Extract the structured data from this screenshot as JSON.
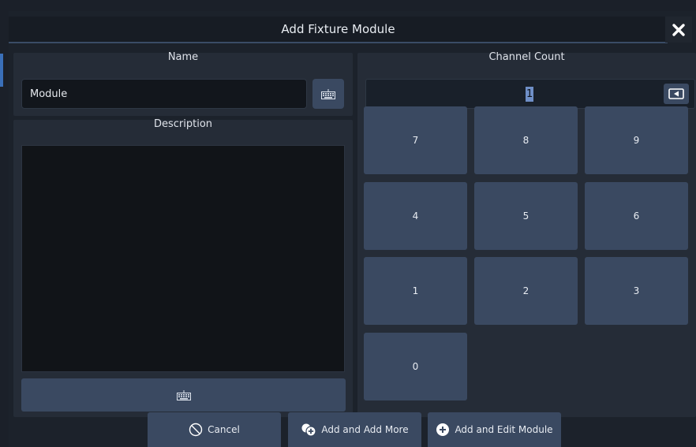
{
  "dialog": {
    "title": "Add Fixture Module",
    "close_icon": "close-icon"
  },
  "name_section": {
    "label": "Name",
    "value": "Module",
    "keyboard_icon": "keyboard-icon"
  },
  "description_section": {
    "label": "Description",
    "value": "",
    "keyboard_icon": "keyboard-icon"
  },
  "channel_count": {
    "label": "Channel Count",
    "value": "1",
    "backspace_icon": "backspace-icon"
  },
  "keypad": {
    "keys": [
      "7",
      "8",
      "9",
      "4",
      "5",
      "6",
      "1",
      "2",
      "3",
      "0"
    ]
  },
  "footer": {
    "cancel_label": "Cancel",
    "add_more_label": "Add and Add More",
    "add_edit_label": "Add and Edit Module"
  },
  "colors": {
    "background": "#1c222b",
    "panel": "#252c37",
    "button": "#3a4961",
    "accent": "#3a4c66",
    "selection": "#6f8fc7"
  }
}
